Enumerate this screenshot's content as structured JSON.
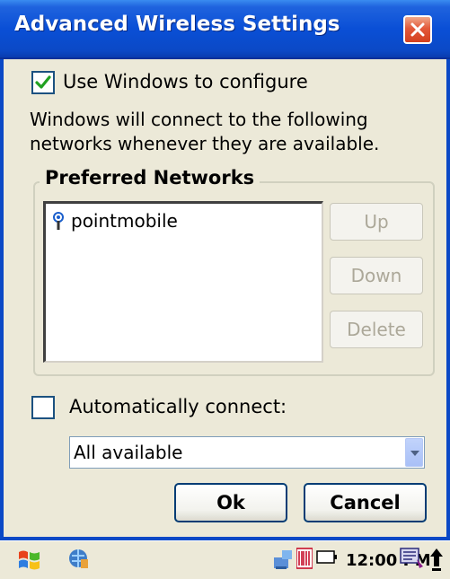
{
  "window": {
    "title": "Advanced Wireless Settings"
  },
  "use_windows": {
    "label": "Use Windows to configure",
    "checked": true
  },
  "description": {
    "line1": "Windows will connect to the following",
    "line2": "networks whenever they are available."
  },
  "preferred": {
    "legend": "Preferred Networks",
    "networks": [
      {
        "name": "pointmobile",
        "icon": "wireless-network-icon"
      }
    ],
    "buttons": {
      "up": "Up",
      "down": "Down",
      "delete": "Delete"
    }
  },
  "auto_connect": {
    "label": "Automatically connect:",
    "checked": false
  },
  "network_type": {
    "value": "All available"
  },
  "actions": {
    "ok": "Ok",
    "cancel": "Cancel"
  },
  "taskbar": {
    "clock": "12:00 PM"
  },
  "colors": {
    "titlebar": "#0A4FD6",
    "close": "#D4401F",
    "background": "#ECE9D8"
  }
}
